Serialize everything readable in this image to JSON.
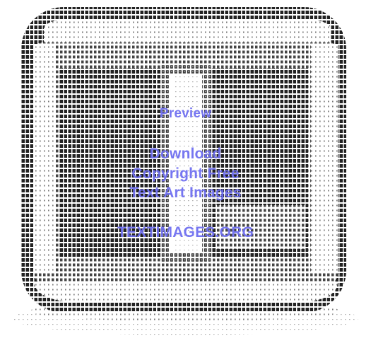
{
  "watermark": {
    "preview": "Preview",
    "download": "Download",
    "copyright": "Copyright Free",
    "text_art": "Text Art Images",
    "site": "TEXTIMAGES.ORG"
  },
  "colors": {
    "background": "#ffffff",
    "ink_dark": "#1a1a1a",
    "ink_mid": "#555555",
    "ink_light": "#9a9a9a",
    "watermark": "#6c6cf0"
  },
  "art": {
    "kind": "ascii-text-art",
    "subject": "rounded-square-icon-with-bar-symbol"
  }
}
